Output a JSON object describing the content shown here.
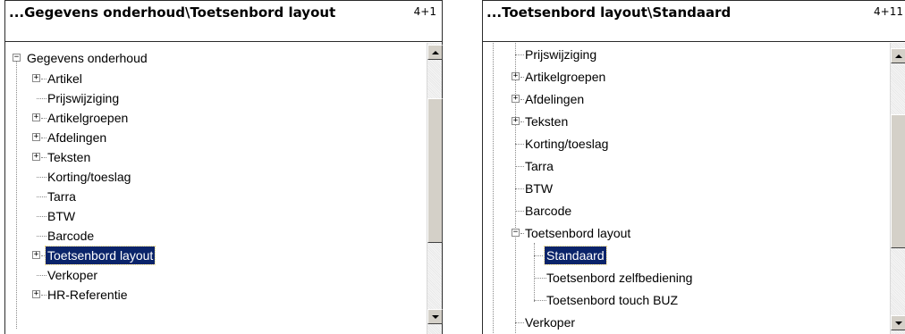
{
  "left_panel": {
    "path_title": "...Gegevens onderhoud\\Toetsenbord layout",
    "code": "4+1",
    "tree": {
      "root": "Gegevens onderhoud",
      "items": [
        "Artikel",
        "Prijswijziging",
        "Artikelgroepen",
        "Afdelingen",
        "Teksten",
        "Korting/toeslag",
        "Tarra",
        "BTW",
        "Barcode",
        "Toetsenbord layout",
        "Verkoper",
        "HR-Referentie"
      ]
    },
    "selected_item": "Toetsenbord layout"
  },
  "right_panel": {
    "path_title": "...Toetsenbord layout\\Standaard",
    "code": "4+11",
    "tree": {
      "items": [
        "Prijswijziging",
        "Artikelgroepen",
        "Afdelingen",
        "Teksten",
        "Korting/toeslag",
        "Tarra",
        "BTW",
        "Barcode",
        "Toetsenbord layout",
        "Verkoper"
      ],
      "children": [
        "Standaard",
        "Toetsenbord zelfbediening",
        "Toetsenbord touch BUZ"
      ]
    },
    "selected_item": "Standaard"
  },
  "colors": {
    "selection_bg": "#0a246a",
    "selection_fg": "#ffffff",
    "tree_lines": "#8a8a8a",
    "scrollbar_face": "#d4d0c8"
  },
  "icons": {
    "expand": "plus-box-icon",
    "collapse": "minus-box-icon",
    "scroll_up": "arrow-up-icon",
    "scroll_down": "arrow-down-icon"
  }
}
